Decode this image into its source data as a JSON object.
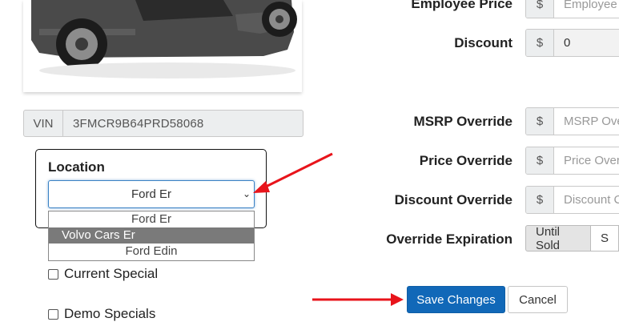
{
  "vehicle": {
    "vin_label": "VIN",
    "vin_value": "3FMCR9B64PRD58068"
  },
  "location": {
    "title": "Location",
    "selected": "Ford Er",
    "options": [
      "Ford Er",
      "Volvo Cars Er",
      "Ford Edin"
    ],
    "highlighted_option": "Volvo Cars Er"
  },
  "specials": {
    "current_label": "Current Special",
    "demo_label": "Demo Specials"
  },
  "pricing": {
    "employee_price_label": "Employee Price",
    "employee_price_placeholder": "Employee",
    "discount_label": "Discount",
    "discount_value": "0",
    "msrp_override_label": "MSRP Override",
    "msrp_override_placeholder": "MSRP Ove",
    "price_override_label": "Price Override",
    "price_override_placeholder": "Price Over",
    "discount_override_label": "Discount Override",
    "discount_override_placeholder": "Discount C",
    "override_expiration_label": "Override Expiration",
    "until_sold_label": "Until Sold",
    "second_option_label": "S",
    "currency_symbol": "$"
  },
  "actions": {
    "save_label": "Save Changes",
    "cancel_label": "Cancel"
  },
  "colors": {
    "primary": "#1168b8",
    "annotation_arrow": "#e8141b"
  }
}
